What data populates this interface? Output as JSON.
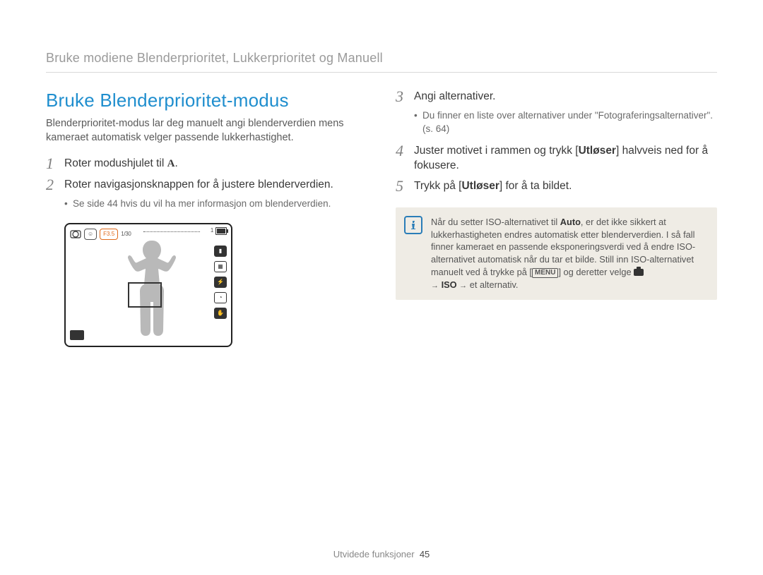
{
  "header": {
    "breadcrumb": "Bruke modiene Blenderprioritet, Lukkerprioritet og Manuell"
  },
  "left": {
    "heading": "Bruke Blenderprioritet-modus",
    "intro": "Blenderprioritet-modus lar deg manuelt angi blenderverdien mens kameraet automatisk velger passende lukkerhastighet.",
    "step1": {
      "num": "1",
      "text_before_icon": "Roter modushjulet til ",
      "mode_letter": "A",
      "text_after_icon": "."
    },
    "step2": {
      "num": "2",
      "text": "Roter navigasjonsknappen for å justere blenderverdien.",
      "sub": "Se side 44 hvis du vil ha mer informasjon om blenderverdien."
    },
    "lcd": {
      "aperture_label": "F3.5",
      "shutter_label": "1/30",
      "battery_label": "1",
      "battery_icon": "battery-icon",
      "icons_right": [
        "hist-icon",
        "grid-icon",
        "flash-icon",
        "timer-icon",
        "stabilizer-icon"
      ]
    }
  },
  "right": {
    "step3": {
      "num": "3",
      "text": "Angi alternativer.",
      "sub": "Du finner en liste over alternativer under \"Fotograferingsalternativer\". (s. 64)"
    },
    "step4": {
      "num": "4",
      "text_before": "Juster motivet i rammen og trykk [",
      "button": "Utløser",
      "text_after": "] halvveis ned for å fokusere."
    },
    "step5": {
      "num": "5",
      "text_before": "Trykk på [",
      "button": "Utløser",
      "text_after": "] for å ta bildet."
    },
    "info": {
      "text_before_auto": "Når du setter ISO-alternativet til ",
      "auto_word": "Auto",
      "text_mid": ", er det ikke sikkert at lukkerhastigheten endres automatisk etter blenderverdien. I så fall finner kameraet en passende eksponeringsverdi ved å endre ISO-alternativet automatisk når du tar et bilde. Still inn ISO-alternativet manuelt ved å trykke på [",
      "menu_word": "MENU",
      "text_after_menu": "] og deretter velge ",
      "iso_word": "ISO",
      "tail": " et alternativ."
    }
  },
  "footer": {
    "section": "Utvidede funksjoner",
    "page": "45"
  }
}
